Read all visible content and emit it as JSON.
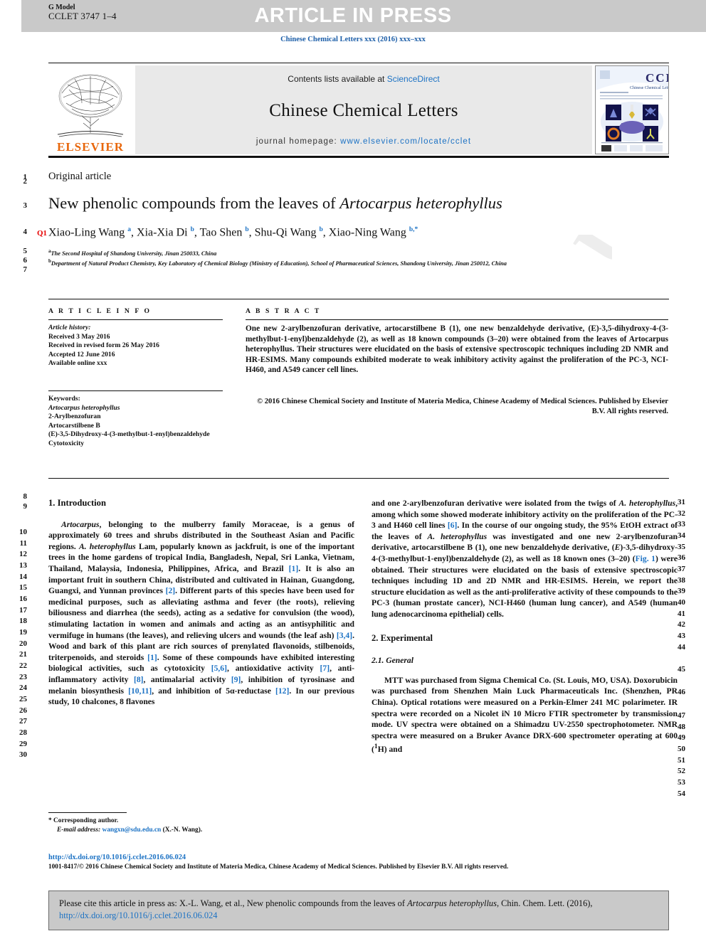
{
  "header": {
    "g_model_label": "G Model",
    "g_model_code": "CCLET 3747 1–4",
    "article_in_press": "ARTICLE IN PRESS",
    "journal_ref": "Chinese Chemical Letters xxx (2016) xxx–xxx"
  },
  "masthead": {
    "contents_prefix": "Contents lists available at ",
    "contents_link": "ScienceDirect",
    "journal_title": "Chinese Chemical Letters",
    "homepage_prefix": "journal homepage: ",
    "homepage_link": "www.elsevier.com/locate/cclet",
    "publisher": "ELSEVIER",
    "cover_title": "CCL",
    "cover_subtitle": "Chinese Chemical Letters"
  },
  "article": {
    "kind": "Original article",
    "title_plain": "New phenolic compounds from the leaves of ",
    "title_italic": "Artocarpus heterophyllus",
    "query_marker": "Q1",
    "authors": "Xiao-Ling Wang a, Xia-Xia Di b, Tao Shen b, Shu-Qi Wang b, Xiao-Ning Wang b,*",
    "affiliation_a": "The Second Hospital of Shandong University, Jinan 250033, China",
    "affiliation_b": "Department of Natural Product Chemistry, Key Laboratory of Chemical Biology (Ministry of Education), School of Pharmaceutical Sciences, Shandong University, Jinan 250012, China"
  },
  "article_info": {
    "heading": "A R T I C L E   I N F O",
    "history_label": "Article history:",
    "history": [
      "Received 3 May 2016",
      "Received in revised form 26 May 2016",
      "Accepted 12 June 2016",
      "Available online xxx"
    ],
    "keywords_label": "Keywords:",
    "keywords": [
      "Artocarpus heterophyllus",
      "2-Arylbenzofuran",
      "Artocarstilbene B",
      "(E)-3,5-Dihydroxy-4-(3-methylbut-1-enyl)benzaldehyde",
      "Cytotoxicity"
    ]
  },
  "abstract": {
    "heading": "A B S T R A C T",
    "text": "One new 2-arylbenzofuran derivative, artocarstilbene B (1), one new benzaldehyde derivative, (E)-3,5-dihydroxy-4-(3-methylbut-1-enyl)benzaldehyde (2), as well as 18 known compounds (3–20) were obtained from the leaves of Artocarpus heterophyllus. Their structures were elucidated on the basis of extensive spectroscopic techniques including 2D NMR and HR-ESIMS. Many compounds exhibited moderate to weak inhibitory activity against the proliferation of the PC-3, NCI-H460, and A549 cancer cell lines.",
    "copyright": "© 2016 Chinese Chemical Society and Institute of Materia Medica, Chinese Academy of Medical Sciences. Published by Elsevier B.V. All rights reserved."
  },
  "body": {
    "intro_heading": "1. Introduction",
    "intro_p1": "Artocarpus, belonging to the mulberry family Moraceae, is a genus of approximately 60 trees and shrubs distributed in the Southeast Asian and Pacific regions. A. heterophyllus Lam, popularly known as jackfruit, is one of the important trees in the home gardens of tropical India, Bangladesh, Nepal, Sri Lanka, Vietnam, Thailand, Malaysia, Indonesia, Philippines, Africa, and Brazil [1]. It is also an important fruit in southern China, distributed and cultivated in Hainan, Guangdong, Guangxi, and Yunnan provinces [2]. Different parts of this species have been used for medicinal purposes, such as alleviating asthma and fever (the roots), relieving biliousness and diarrhea (the seeds), acting as a sedative for convulsion (the wood), stimulating lactation in women and animals and acting as an antisyphilitic and vermifuge in humans (the leaves), and relieving ulcers and wounds (the leaf ash) [3,4]. Wood and bark of this plant are rich sources of prenylated flavonoids, stilbenoids, triterpenoids, and steroids [1]. Some of these compounds have exhibited interesting biological activities, such as cytotoxicity [5,6], antioxidative activity [7], anti-inflammatory activity [8], antimalarial activity [9], inhibition of tyrosinase and melanin biosynthesis [10,11], and inhibition of 5α-reductase [12]. In our previous study, 10 chalcones, 8 flavones",
    "intro_p1_cont": "and one 2-arylbenzofuran derivative were isolated from the twigs of A. heterophyllus, among which some showed moderate inhibitory activity on the proliferation of the PC-3 and H460 cell lines [6]. In the course of our ongoing study, the 95% EtOH extract of the leaves of A. heterophyllus was investigated and one new 2-arylbenzofuran derivative, artocarstilbene B (1), one new benzaldehyde derivative, (E)-3,5-dihydroxy-4-(3-methylbut-1-enyl)benzaldehyde (2), as well as 18 known ones (3–20) (Fig. 1) were obtained. Their structures were elucidated on the basis of extensive spectroscopic techniques including 1D and 2D NMR and HR-ESIMS. Herein, we report the structure elucidation as well as the anti-proliferative activity of these compounds to the PC-3 (human prostate cancer), NCI-H460 (human lung cancer), and A549 (human lung adenocarcinoma epithelial) cells.",
    "exp_heading": "2. Experimental",
    "general_heading": "2.1. General",
    "general_p1": "MTT was purchased from Sigma Chemical Co. (St. Louis, MO, USA). Doxorubicin was purchased from Shenzhen Main Luck Pharmaceuticals Inc. (Shenzhen, PR China). Optical rotations were measured on a Perkin-Elmer 241 MC polarimeter. IR spectra were recorded on a Nicolet iN 10 Micro FTIR spectrometer by transmission mode. UV spectra were obtained on a Shimadzu UV-2550 spectrophotometer. NMR spectra were measured on a Bruker Avance DRX-600 spectrometer operating at 600 (1H) and"
  },
  "footnote": {
    "corresponding": "* Corresponding author.",
    "email_label": "E-mail address: ",
    "email": "wangxn@sdu.edu.cn",
    "email_suffix": " (X.-N. Wang).",
    "doi": "http://dx.doi.org/10.1016/j.cclet.2016.06.024",
    "issn_line": "1001-8417/© 2016 Chinese Chemical Society and Institute of Materia Medica, Chinese Academy of Medical Sciences. Published by Elsevier B.V. All rights reserved."
  },
  "citation": {
    "text_before": "Please cite this article in press as: X.-L. Wang, et al., New phenolic compounds from the leaves of ",
    "text_italic": "Artocarpus heterophyllus",
    "text_after": ", Chin. Chem. Lett. (2016), ",
    "link": "http://dx.doi.org/10.1016/j.cclet.2016.06.024"
  },
  "line_numbers": {
    "left": [
      "1",
      "2",
      "3",
      "4",
      "5",
      "6",
      "7",
      "8",
      "9",
      "10",
      "11",
      "12",
      "13",
      "14",
      "15",
      "16",
      "17",
      "18",
      "19",
      "20",
      "21",
      "22",
      "23",
      "24",
      "25",
      "26",
      "27",
      "28",
      "29",
      "30"
    ],
    "right": [
      "31",
      "32",
      "33",
      "34",
      "35",
      "36",
      "37",
      "38",
      "39",
      "40",
      "41",
      "42",
      "43",
      "44",
      "45",
      "46",
      "47",
      "48",
      "49",
      "50",
      "51",
      "52",
      "53",
      "54"
    ]
  },
  "watermark": "UNCORRECTED PROOF"
}
